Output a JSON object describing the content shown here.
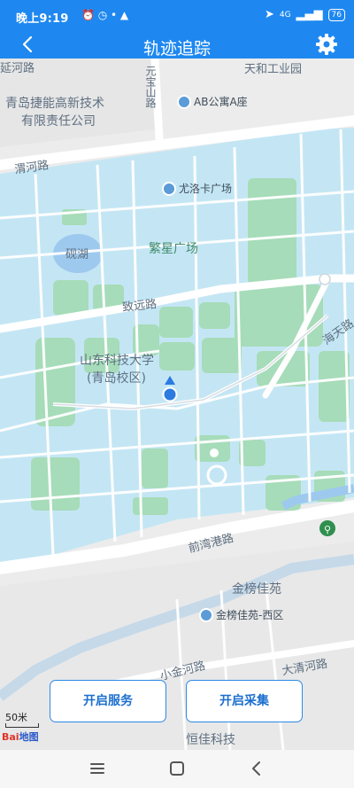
{
  "status_bar": {
    "time": "晚上9:19",
    "network": "4G",
    "battery": "76"
  },
  "header": {
    "title": "轨迹追踪"
  },
  "map": {
    "labels": {
      "tianhe_park": "天和工业园",
      "company": "青岛捷能高新技术",
      "company2": "有限责任公司",
      "road_wei": "渭河路",
      "road_yuanshan": "元宝山路",
      "road_zhiyuan": "致远路",
      "road_haitian": "海天路",
      "lake": "砚湖",
      "plaza": "繁星广场",
      "university": "山东科技大学",
      "campus": "(青岛校区)",
      "road_qianwan": "前湾港路",
      "jinbang": "金榜佳苑",
      "road_xiaojinhe": "小金河路",
      "road_daqinghe": "大清河路",
      "hengjia": "恒佳科技",
      "road_top": "延河路"
    },
    "pois": {
      "ab": "AB公寓A座",
      "youluoka": "尤洛卡广场",
      "jinbang_west": "金榜佳苑-西区"
    },
    "scale": "50米",
    "logo_a": "Bai",
    "logo_b": "地图"
  },
  "buttons": {
    "start_service": "开启服务",
    "start_collect": "开启采集"
  },
  "colors": {
    "primary": "#1e88f0",
    "campus": "#c4e6f4",
    "green": "#a6dcb9",
    "water": "#9ec9ee"
  },
  "icons": [
    "back-arrow-icon",
    "settings-gear-icon",
    "location-dot-icon",
    "menu-icon",
    "home-icon",
    "back-icon"
  ]
}
